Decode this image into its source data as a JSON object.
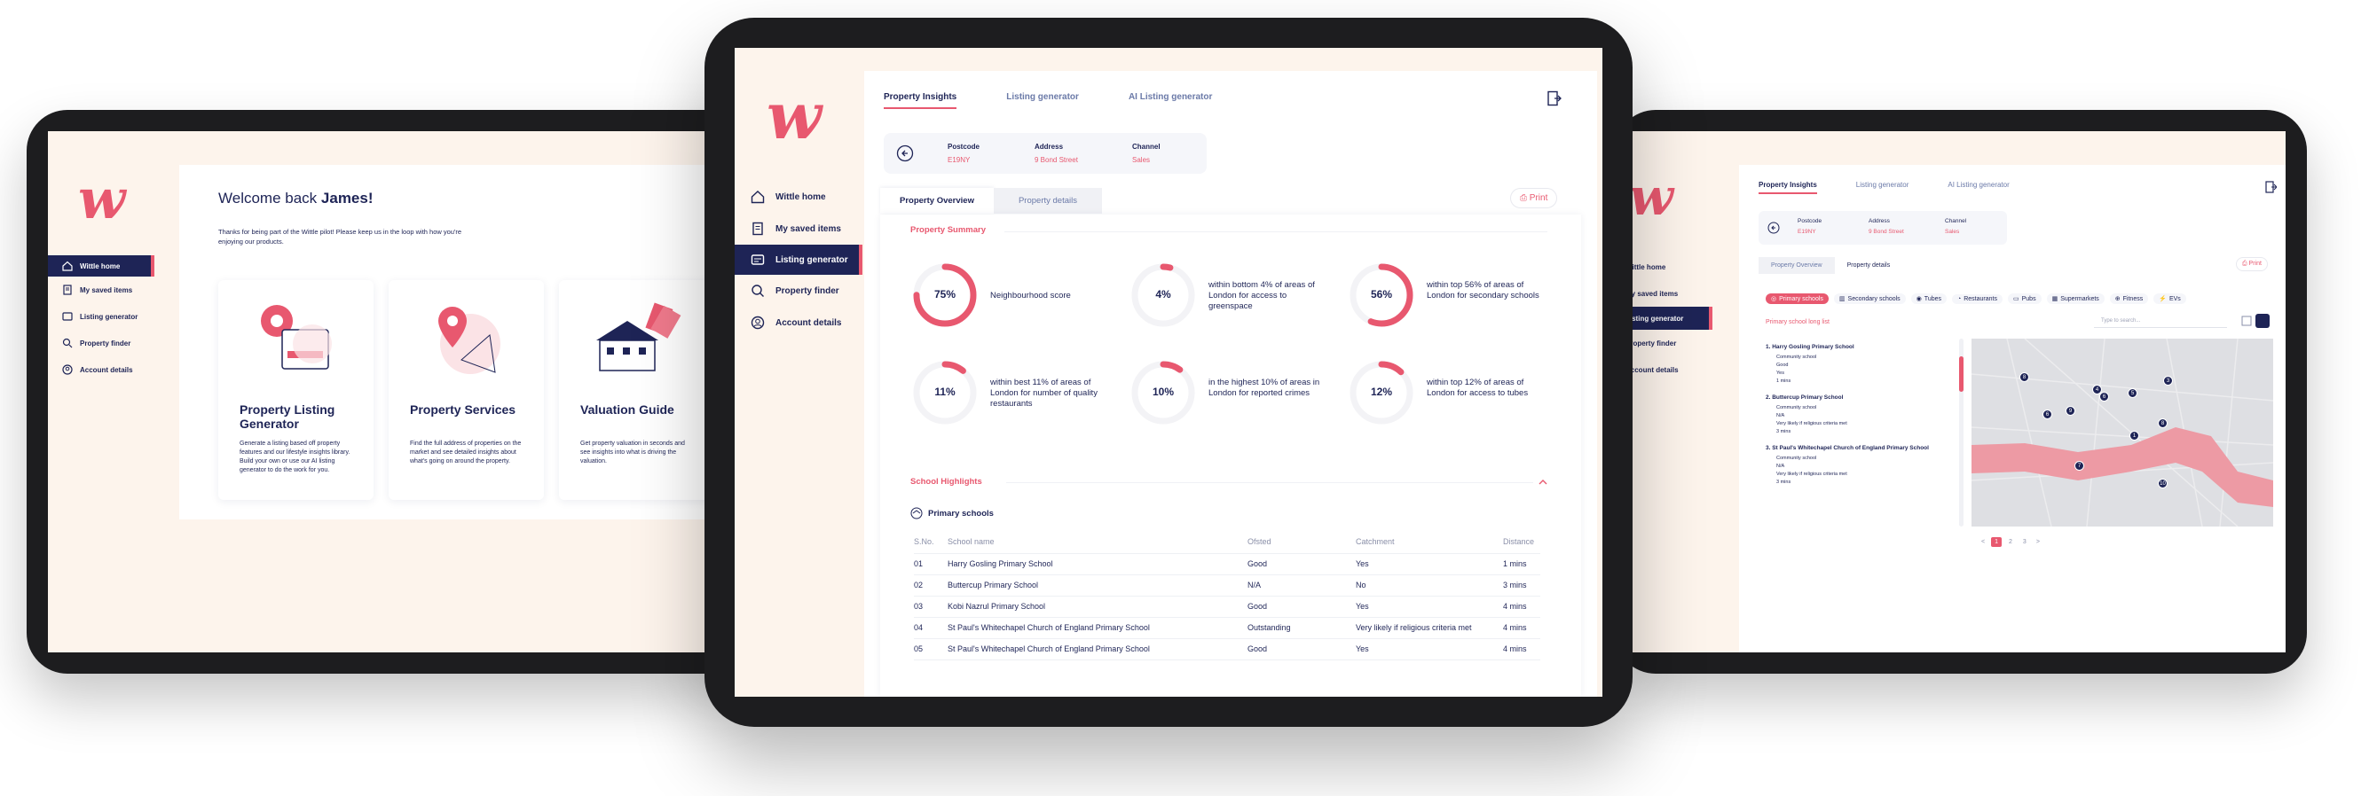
{
  "left": {
    "logo": "w",
    "nav": [
      "Wittle home",
      "My saved items",
      "Listing generator",
      "Property finder",
      "Account details"
    ],
    "welcome_prefix": "Welcome back ",
    "welcome_name": "James!",
    "intro": "Thanks for being part of the Wittle pilot! Please keep us in the loop with how you're enjoying our products.",
    "cards": [
      {
        "title": "Property Listing Generator",
        "desc": "Generate a listing based off property features and our lifestyle insights library. Build your own or use our AI listing generator to do the work for you."
      },
      {
        "title": "Property Services",
        "desc": "Find the full address of properties on the market and see detailed insights about what's going on around the property."
      },
      {
        "title": "Valuation Guide",
        "desc": "Get property valuation in seconds and see insights into what is driving the valuation."
      }
    ]
  },
  "center": {
    "logo": "w",
    "nav": [
      "Wittle home",
      "My saved items",
      "Listing generator",
      "Property finder",
      "Account details"
    ],
    "tabs": [
      "Property Insights",
      "Listing generator",
      "AI Listing generator"
    ],
    "info": [
      {
        "label": "Postcode",
        "value": "E19NY"
      },
      {
        "label": "Address",
        "value": "9 Bond Street"
      },
      {
        "label": "Channel",
        "value": "Sales"
      }
    ],
    "subtabs": [
      "Property Overview",
      "Property details"
    ],
    "print": "Print",
    "summary_title": "Property Summary",
    "kpis": [
      {
        "value": "75%",
        "pct": 75,
        "text": "Neighbourhood score"
      },
      {
        "value": "4%",
        "pct": 4,
        "text": "within bottom 4% of areas of London for access to greenspace"
      },
      {
        "value": "56%",
        "pct": 56,
        "text": "within top 56% of areas of London for secondary schools"
      },
      {
        "value": "11%",
        "pct": 11,
        "text": "within best 11% of areas of London for number of quality restaurants"
      },
      {
        "value": "10%",
        "pct": 10,
        "text": "in the highest 10% of areas in London for reported crimes"
      },
      {
        "value": "12%",
        "pct": 12,
        "text": "within top 12% of areas of London for access to tubes"
      }
    ],
    "highlights_title": "School Highlights",
    "primary_label": "Primary schools",
    "columns": [
      "S.No.",
      "School name",
      "Ofsted",
      "Catchment",
      "Distance"
    ],
    "rows": [
      [
        "01",
        "Harry Gosling Primary School",
        "Good",
        "Yes",
        "1 mins"
      ],
      [
        "02",
        "Buttercup Primary School",
        "N/A",
        "No",
        "3 mins"
      ],
      [
        "03",
        "Kobi Nazrul Primary School",
        "Good",
        "Yes",
        "4 mins"
      ],
      [
        "04",
        "St Paul's Whitechapel Church of England Primary School",
        "Outstanding",
        "Very likely if religious criteria met",
        "4 mins"
      ],
      [
        "05",
        "St Paul's Whitechapel Church of England Primary School",
        "Good",
        "Yes",
        "4 mins"
      ]
    ]
  },
  "right": {
    "logo": "w",
    "nav": [
      "Wittle home",
      "My saved items",
      "Listing generator",
      "Property finder",
      "Account details"
    ],
    "tabs": [
      "Property Insights",
      "Listing generator",
      "AI Listing generator"
    ],
    "info": [
      {
        "label": "Postcode",
        "value": "E19NY"
      },
      {
        "label": "Address",
        "value": "9 Bond Street"
      },
      {
        "label": "Channel",
        "value": "Sales"
      }
    ],
    "subtabs": [
      "Property Overview",
      "Property details"
    ],
    "print": "Print",
    "chips": [
      "Primary schools",
      "Secondary schools",
      "Tubes",
      "Restaurants",
      "Pubs",
      "Supermarkets",
      "Fitness",
      "EVs"
    ],
    "list_title": "Primary school long list",
    "search_placeholder": "Type to search...",
    "schools": [
      {
        "name": "1. Harry Gosling Primary School",
        "attrs": [
          "Community school",
          "Good",
          "Yes",
          "1 mins"
        ]
      },
      {
        "name": "2. Buttercup Primary School",
        "attrs": [
          "Community school",
          "N/A",
          "Very likely if religious criteria met",
          "3 mins"
        ]
      },
      {
        "name": "3. St Paul's Whitechapel Church of England Primary School",
        "attrs": [
          "Community school",
          "N/A",
          "Very likely if religious criteria met",
          "3 mins"
        ]
      }
    ],
    "pins": [
      "8",
      "4",
      "6",
      "5",
      "9",
      "1",
      "8",
      "7",
      "10",
      "3",
      "6"
    ],
    "pages": [
      "<",
      "1",
      "2",
      "3",
      ">"
    ]
  },
  "colors": {
    "accent": "#e8586f",
    "navy": "#1e2456",
    "screen_bg": "#fdf4ec"
  }
}
